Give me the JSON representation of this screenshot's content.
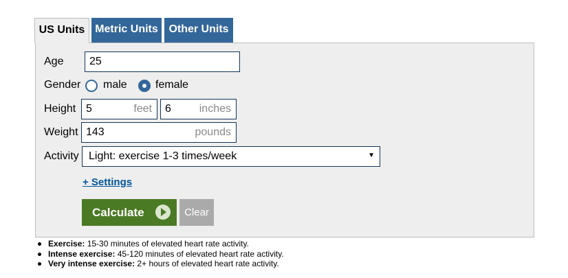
{
  "tabs": [
    {
      "label": "US Units",
      "active": true
    },
    {
      "label": "Metric Units",
      "active": false
    },
    {
      "label": "Other Units",
      "active": false
    }
  ],
  "form": {
    "age": {
      "label": "Age",
      "value": "25"
    },
    "gender": {
      "label": "Gender",
      "options": [
        "male",
        "female"
      ],
      "selected": "female"
    },
    "height": {
      "label": "Height",
      "feet": "5",
      "feet_unit": "feet",
      "inches": "6",
      "inches_unit": "inches"
    },
    "weight": {
      "label": "Weight",
      "value": "143",
      "unit": "pounds"
    },
    "activity": {
      "label": "Activity",
      "selected": "Light: exercise 1-3 times/week"
    }
  },
  "settings_link": "+ Settings",
  "buttons": {
    "calculate": "Calculate",
    "clear": "Clear"
  },
  "notes": [
    {
      "term": "Exercise:",
      "text": " 15-30 minutes of elevated heart rate activity."
    },
    {
      "term": "Intense exercise:",
      "text": " 45-120 minutes of elevated heart rate activity."
    },
    {
      "term": "Very intense exercise:",
      "text": " 2+ hours of elevated heart rate activity."
    }
  ],
  "colors": {
    "tab_blue": "#336699",
    "calculate_green": "#4b7a24",
    "clear_gray": "#aaaaaa",
    "link_blue": "#005599"
  }
}
